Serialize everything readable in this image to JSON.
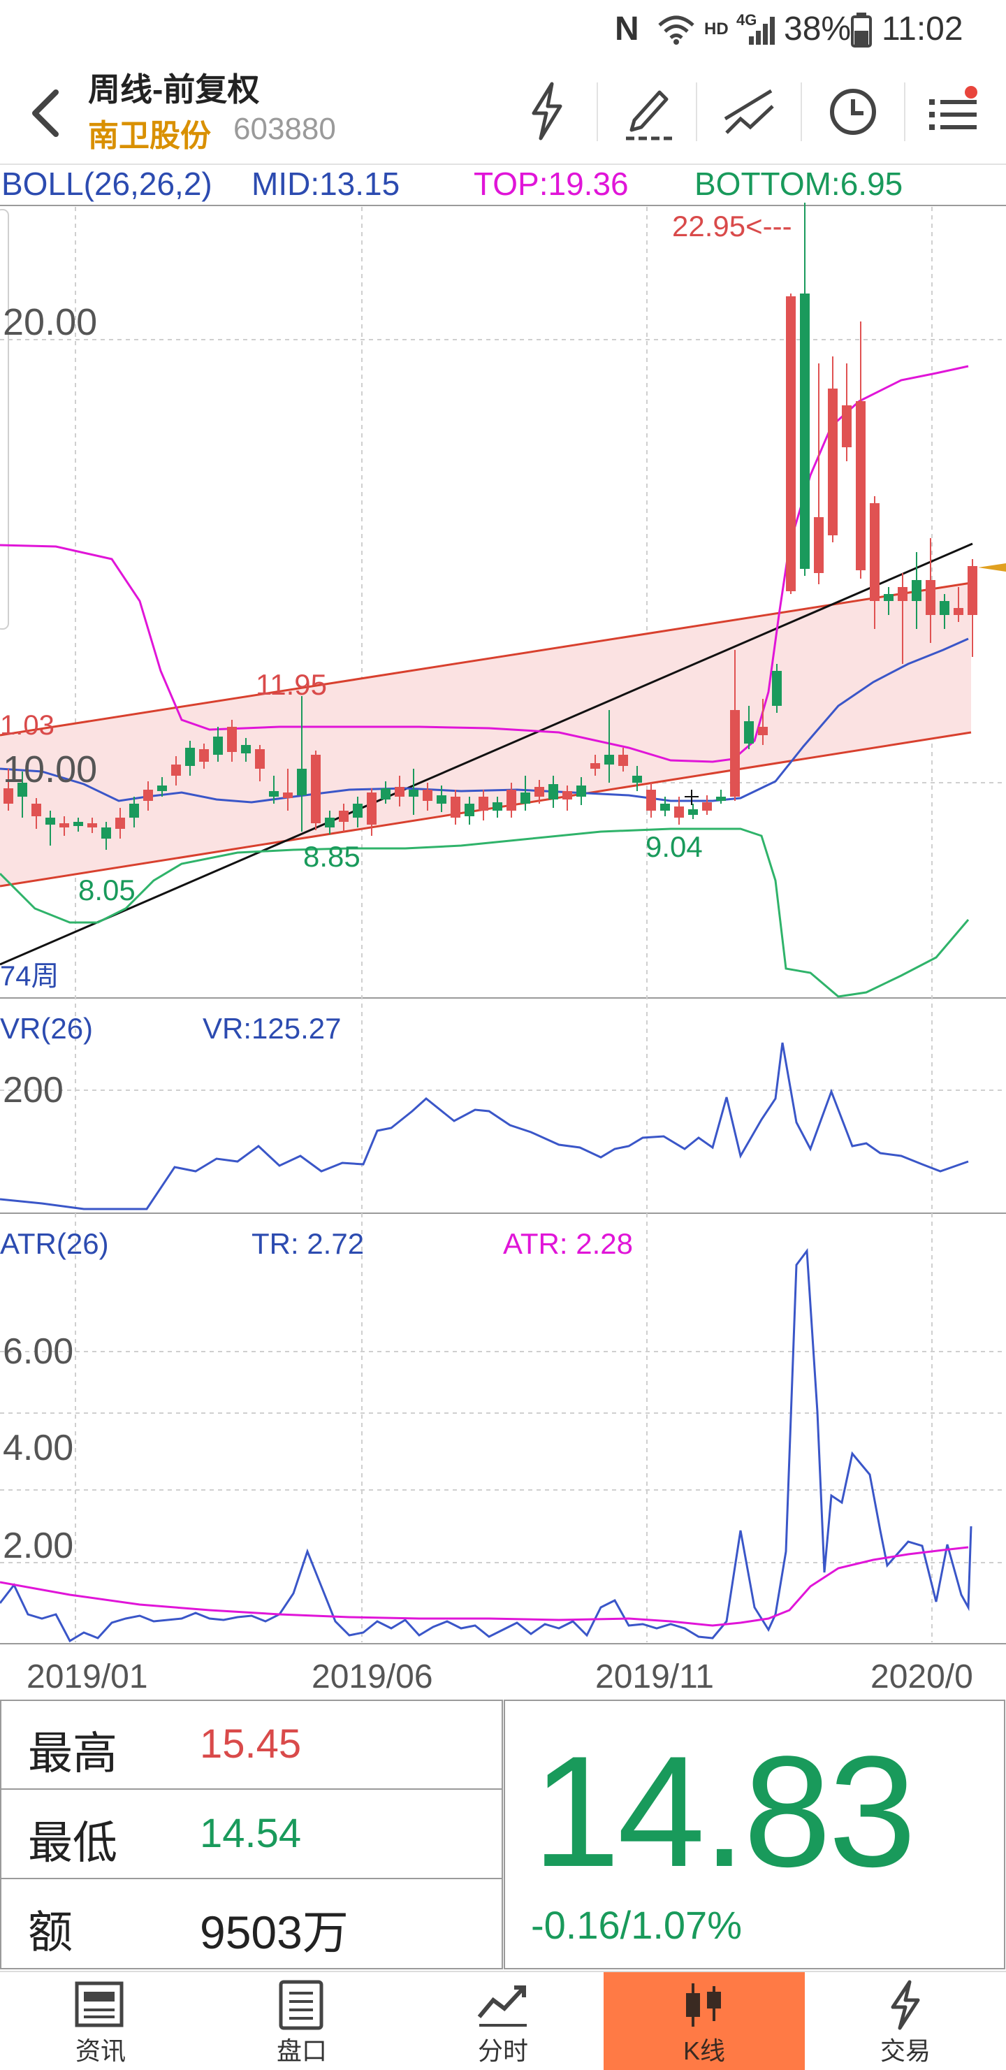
{
  "status_bar": {
    "nfc": "N",
    "hd": "HD",
    "net": "4G",
    "battery": "38%",
    "time": "11:02"
  },
  "header": {
    "title": "周线-前复权",
    "stock_name": "南卫股份",
    "stock_code": "603880",
    "icons": [
      "back-icon",
      "lightning-icon",
      "pen-icon",
      "trendline-icon",
      "clock-icon",
      "menu-icon"
    ]
  },
  "boll": {
    "name": "BOLL(26,26,2)",
    "mid": "MID:13.15",
    "top": "TOP:19.36",
    "bottom": "BOTTOM:6.95"
  },
  "price_axis": {
    "p20": "20.00",
    "p10": "10.00"
  },
  "annotations": {
    "high": "22.95<---",
    "a1195": "11.95",
    "a103": "1.03",
    "a805": "8.05",
    "a885": "8.85",
    "a904": "9.04",
    "weeks": "74周"
  },
  "vr": {
    "name": "VR(26)",
    "value": "VR:125.27",
    "axis_200": "200"
  },
  "atr": {
    "name": "ATR(26)",
    "tr": "TR: 2.72",
    "atr": "ATR: 2.28",
    "axis": [
      "6.00",
      "4.00",
      "2.00"
    ]
  },
  "dates": [
    "2019/01",
    "2019/06",
    "2019/11",
    "2020/0"
  ],
  "info": {
    "high_label": "最高",
    "high_value": "15.45",
    "low_label": "最低",
    "low_value": "14.54",
    "amount_label": "额",
    "amount_value": "9503万",
    "price": "14.83",
    "change": "-0.16/1.07%"
  },
  "nav": [
    {
      "label": "资讯",
      "icon": "news-icon"
    },
    {
      "label": "盘口",
      "icon": "orderbook-icon"
    },
    {
      "label": "分时",
      "icon": "intraday-icon"
    },
    {
      "label": "K线",
      "icon": "candlestick-icon",
      "active": true
    },
    {
      "label": "交易",
      "icon": "trade-icon"
    }
  ],
  "colors": {
    "up": "#e05252",
    "down": "#1a9a5c",
    "boll_mid": "#3a56c8",
    "boll_top": "#e015d8",
    "boll_bottom": "#2fb36a",
    "accent": "#ff7a45",
    "stock_name": "#d99000"
  }
}
